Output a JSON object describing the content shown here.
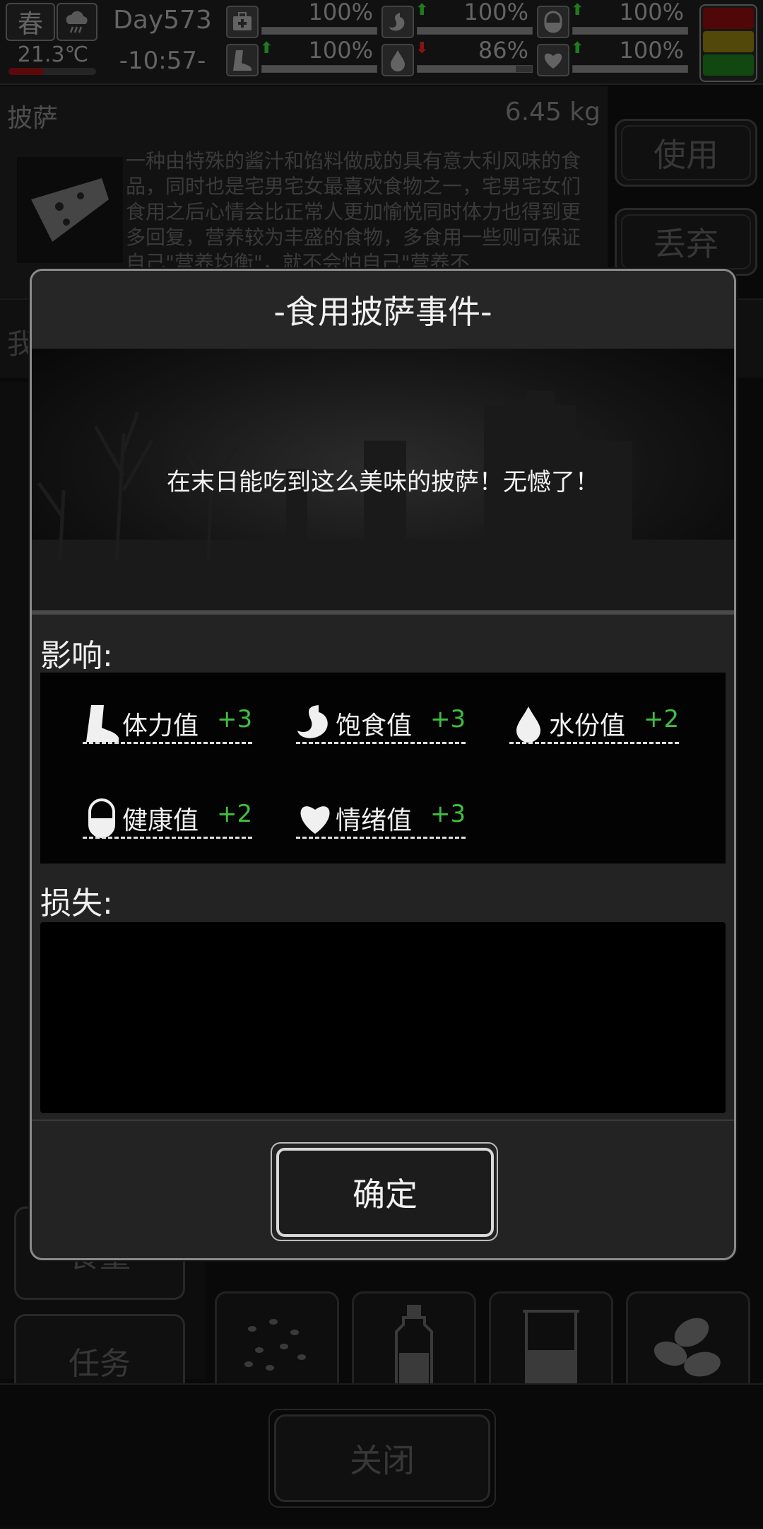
{
  "status": {
    "season": "春",
    "temperature": "21.3℃",
    "day": "Day573",
    "time": "-10:57-",
    "stats": [
      {
        "icon": "first-aid-icon",
        "percent": "100%",
        "fill": 1.0
      },
      {
        "icon": "stomach-icon",
        "percent": "100%",
        "fill": 1.0,
        "arrow": "up"
      },
      {
        "icon": "pill-icon",
        "percent": "100%",
        "fill": 1.0,
        "arrow": "up"
      },
      {
        "icon": "boot-icon",
        "percent": "100%",
        "fill": 1.0,
        "arrow": "up"
      },
      {
        "icon": "water-drop-icon",
        "percent": "86%",
        "fill": 0.86,
        "arrow": "down"
      },
      {
        "icon": "heart-icon",
        "percent": "100%",
        "fill": 1.0,
        "arrow": "up"
      }
    ],
    "colors": {
      "arrow_up": "#2fbf2f",
      "arrow_down": "#d02020",
      "signal_red": "#8a0000",
      "signal_yellow": "#8a7a00",
      "signal_green": "#1f7a1f"
    }
  },
  "item": {
    "name": "披萨",
    "weight": "6.45 kg",
    "description": "一种由特殊的酱汁和馅料做成的具有意大利风味的食品，同时也是宅男宅女最喜欢食物之一，宅男宅女们食用之后心情会比正常人更加愉悦同时体力也得到更多回复，营养较为丰盛的食物，多食用一些则可保证自己\"营养均衡\"，就不会怕自己\"营养不",
    "use_label": "使用",
    "discard_label": "丢弃"
  },
  "side_tabs": {
    "food_label": "食量",
    "task_label": "任务",
    "partial_label": "我"
  },
  "modal": {
    "title": "-食用披萨事件-",
    "scene_text": "在末日能吃到这么美味的披萨！无憾了！",
    "effects_label": "影响:",
    "loss_label": "损失:",
    "effects": [
      {
        "icon": "boot-icon",
        "label": "体力值",
        "value": "+3"
      },
      {
        "icon": "stomach-icon",
        "label": "饱食值",
        "value": "+3"
      },
      {
        "icon": "water-drop-icon",
        "label": "水份值",
        "value": "+2"
      },
      {
        "icon": "pill-icon",
        "label": "健康值",
        "value": "+2"
      },
      {
        "icon": "heart-icon",
        "label": "情绪值",
        "value": "+3"
      }
    ],
    "confirm_label": "确定"
  },
  "bottom": {
    "close_label": "关闭"
  }
}
